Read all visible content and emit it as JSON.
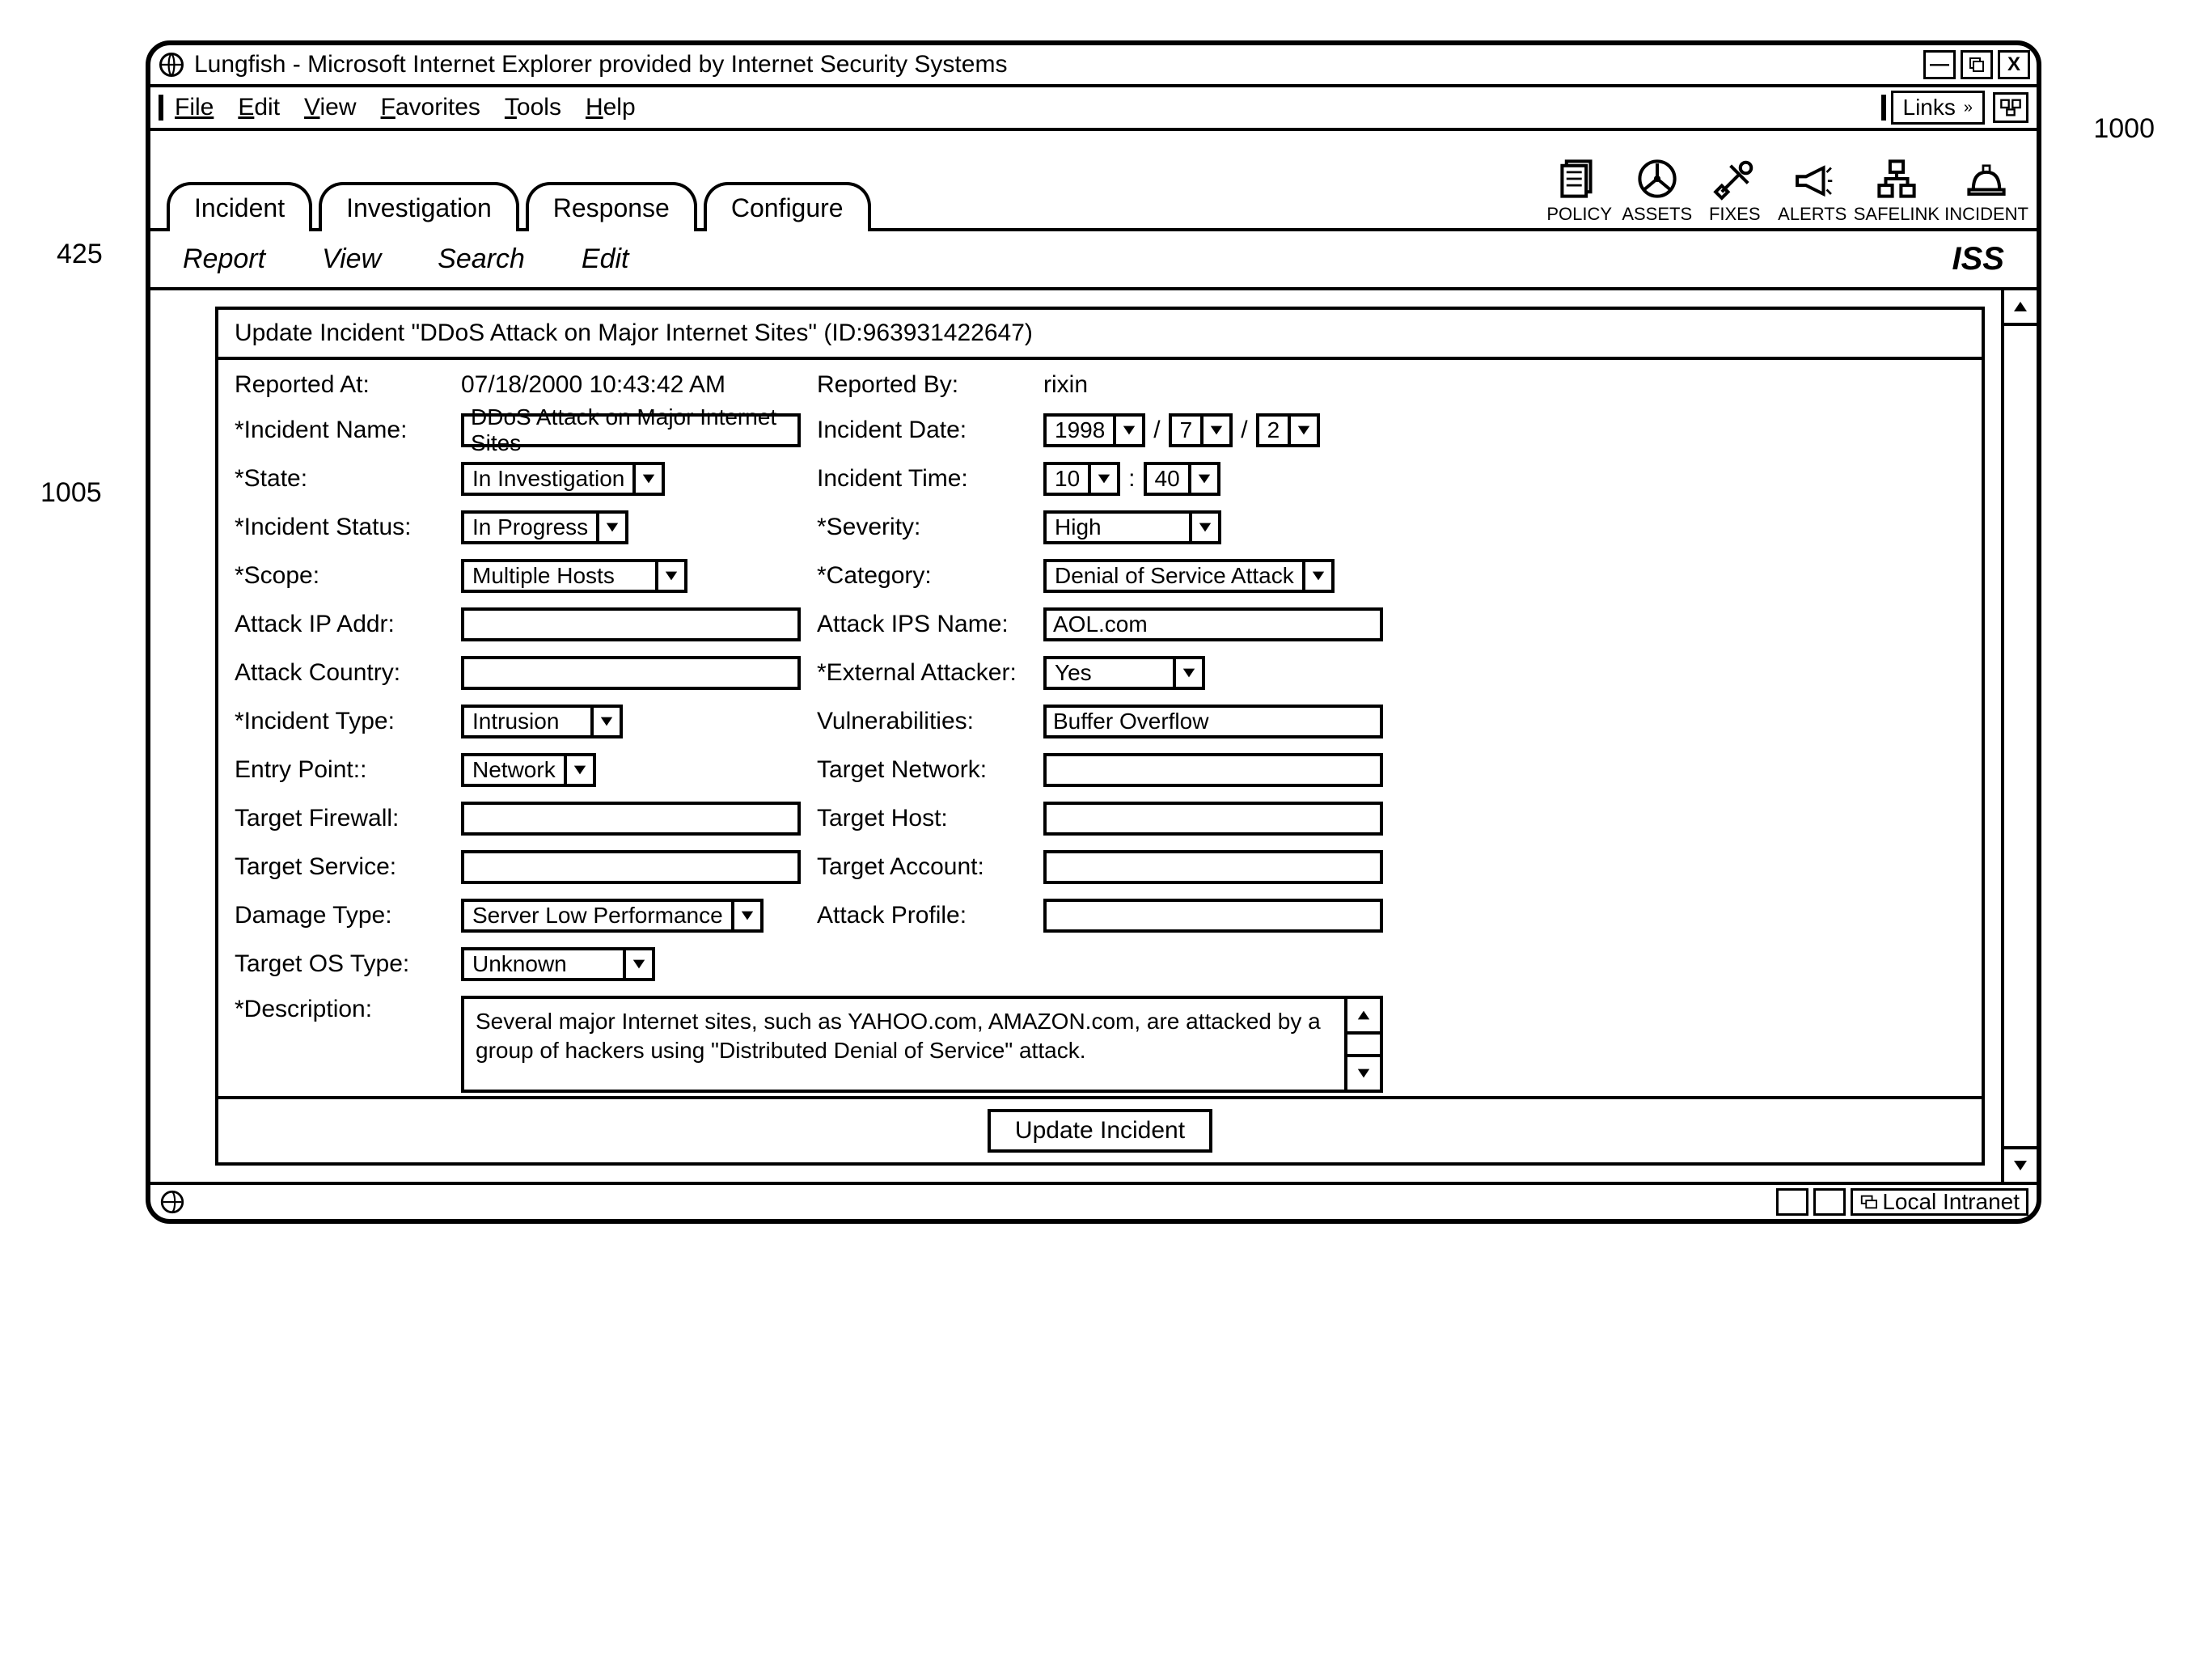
{
  "callouts": {
    "c425": "425",
    "c1000": "1000",
    "c1005": "1005"
  },
  "window_title": "Lungfish - Microsoft Internet Explorer provided by Internet Security Systems",
  "menubar": {
    "file": "File",
    "edit": "Edit",
    "view": "View",
    "favorites": "Favorites",
    "tools": "Tools",
    "help": "Help",
    "links": "Links"
  },
  "toolbar": {
    "policy": "POLICY",
    "assets": "ASSETS",
    "fixes": "FIXES",
    "alerts": "ALERTS",
    "safelink": "SAFELINK",
    "incident": "INCIDENT"
  },
  "tabs": {
    "incident": "Incident",
    "investigation": "Investigation",
    "response": "Response",
    "configure": "Configure"
  },
  "subbar": {
    "report": "Report",
    "view": "View",
    "search": "Search",
    "edit": "Edit",
    "brand": "ISS"
  },
  "panel_header": "Update Incident \"DDoS Attack on Major Internet Sites\" (ID:963931422647)",
  "form": {
    "reported_at_label": "Reported At:",
    "reported_at_value": "07/18/2000 10:43:42 AM",
    "reported_by_label": "Reported By:",
    "reported_by_value": "rixin",
    "incident_name_label": "*Incident Name:",
    "incident_name_value": "DDoS Attack on Major Internet Sites",
    "incident_date_label": "Incident Date:",
    "incident_date_year": "1998",
    "incident_date_month": "7",
    "incident_date_day": "2",
    "state_label": "*State:",
    "state_value": "In Investigation",
    "incident_time_label": "Incident Time:",
    "incident_time_hour": "10",
    "incident_time_min": "40",
    "incident_status_label": "*Incident Status:",
    "incident_status_value": "In Progress",
    "severity_label": "*Severity:",
    "severity_value": "High",
    "scope_label": "*Scope:",
    "scope_value": "Multiple Hosts",
    "category_label": "*Category:",
    "category_value": "Denial of Service Attack",
    "attack_ip_label": "Attack IP Addr:",
    "attack_ip_value": "",
    "attack_ips_name_label": "Attack IPS Name:",
    "attack_ips_name_value": "AOL.com",
    "attack_country_label": "Attack Country:",
    "attack_country_value": "",
    "external_attacker_label": "*External Attacker:",
    "external_attacker_value": "Yes",
    "incident_type_label": "*Incident Type:",
    "incident_type_value": "Intrusion",
    "vulnerabilities_label": "Vulnerabilities:",
    "vulnerabilities_value": "Buffer Overflow",
    "entry_point_label": "Entry Point::",
    "entry_point_value": "Network",
    "target_network_label": "Target Network:",
    "target_network_value": "",
    "target_firewall_label": "Target Firewall:",
    "target_firewall_value": "",
    "target_host_label": "Target Host:",
    "target_host_value": "",
    "target_service_label": "Target Service:",
    "target_service_value": "",
    "target_account_label": "Target Account:",
    "target_account_value": "",
    "damage_type_label": "Damage Type:",
    "damage_type_value": "Server Low Performance",
    "attack_profile_label": "Attack Profile:",
    "attack_profile_value": "",
    "target_os_label": "Target OS Type:",
    "target_os_value": "Unknown",
    "description_label": "*Description:",
    "description_value": "Several major Internet sites, such as YAHOO.com, AMAZON.com, are attacked by a group of hackers using \"Distributed Denial of Service\" attack."
  },
  "update_button": "Update Incident",
  "statusbar": {
    "zone": "Local Intranet"
  }
}
